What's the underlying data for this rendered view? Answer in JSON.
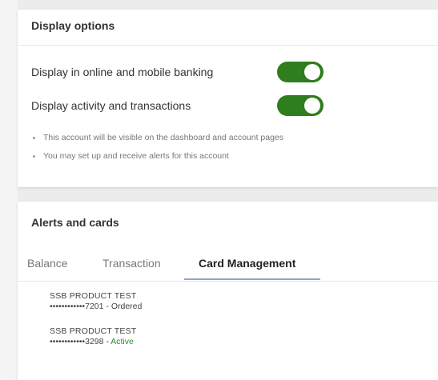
{
  "colors": {
    "toggle_on": "#2f7d1c",
    "status_active": "#2e8b2e"
  },
  "display_options": {
    "title": "Display options",
    "settings": [
      {
        "label": "Display in online and mobile banking",
        "enabled": true
      },
      {
        "label": "Display activity and transactions",
        "enabled": true
      }
    ],
    "notes": [
      "This account will be visible on the dashboard and account pages",
      "You may set up and receive alerts for this account"
    ]
  },
  "alerts_and_cards": {
    "title": "Alerts and cards",
    "tabs": [
      {
        "label": "Balance",
        "active": false
      },
      {
        "label": "Transaction",
        "active": false
      },
      {
        "label": "Card Management",
        "active": true
      }
    ],
    "cards": [
      {
        "name": "SSB PRODUCT TEST",
        "number": "••••••••••••7201",
        "separator": " - ",
        "status": "Ordered"
      },
      {
        "name": "SSB PRODUCT TEST",
        "number": "••••••••••••3298",
        "separator": " - ",
        "status": "Active"
      }
    ]
  }
}
